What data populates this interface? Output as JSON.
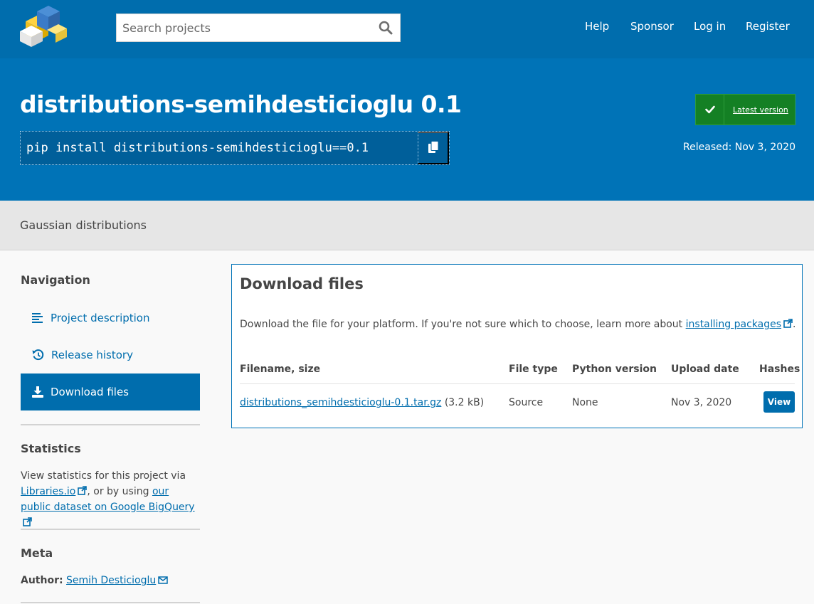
{
  "header": {
    "search_placeholder": "Search projects",
    "nav": {
      "help": "Help",
      "sponsor": "Sponsor",
      "login": "Log in",
      "register": "Register"
    }
  },
  "package": {
    "title": "distributions-semihdesticioglu 0.1",
    "pip_command": "pip install distributions-semihdesticioglu==0.1",
    "latest_label": "Latest version",
    "released": "Released: Nov 3, 2020",
    "summary": "Gaussian distributions"
  },
  "sidebar": {
    "navigation_heading": "Navigation",
    "items": [
      {
        "label": "Project description",
        "icon": "align-left-icon"
      },
      {
        "label": "Release history",
        "icon": "history-icon"
      },
      {
        "label": "Download files",
        "icon": "download-icon",
        "active": true
      }
    ],
    "statistics_heading": "Statistics",
    "statistics_text_1": "View statistics for this project via",
    "statistics_link_1": "Libraries.io",
    "statistics_text_2": ", or by using",
    "statistics_link_2": "our public dataset on Google BigQuery",
    "meta_heading": "Meta",
    "author_label": "Author:",
    "author_name": "Semih Desticioglu"
  },
  "download": {
    "title": "Download files",
    "intro": "Download the file for your platform. If you're not sure which to choose, learn more about",
    "intro_link": "installing packages",
    "intro_end": ".",
    "columns": [
      "Filename, size",
      "File type",
      "Python version",
      "Upload date",
      "Hashes"
    ],
    "rows": [
      {
        "filename": "distributions_semihdesticioglu-0.1.tar.gz",
        "size": "(3.2 kB)",
        "file_type": "Source",
        "python_version": "None",
        "upload_date": "Nov 3, 2020",
        "hashes_button": "View"
      }
    ]
  },
  "colors": {
    "brand_blue": "#006dad",
    "banner_blue": "#0073b7",
    "success_green": "#148024"
  }
}
